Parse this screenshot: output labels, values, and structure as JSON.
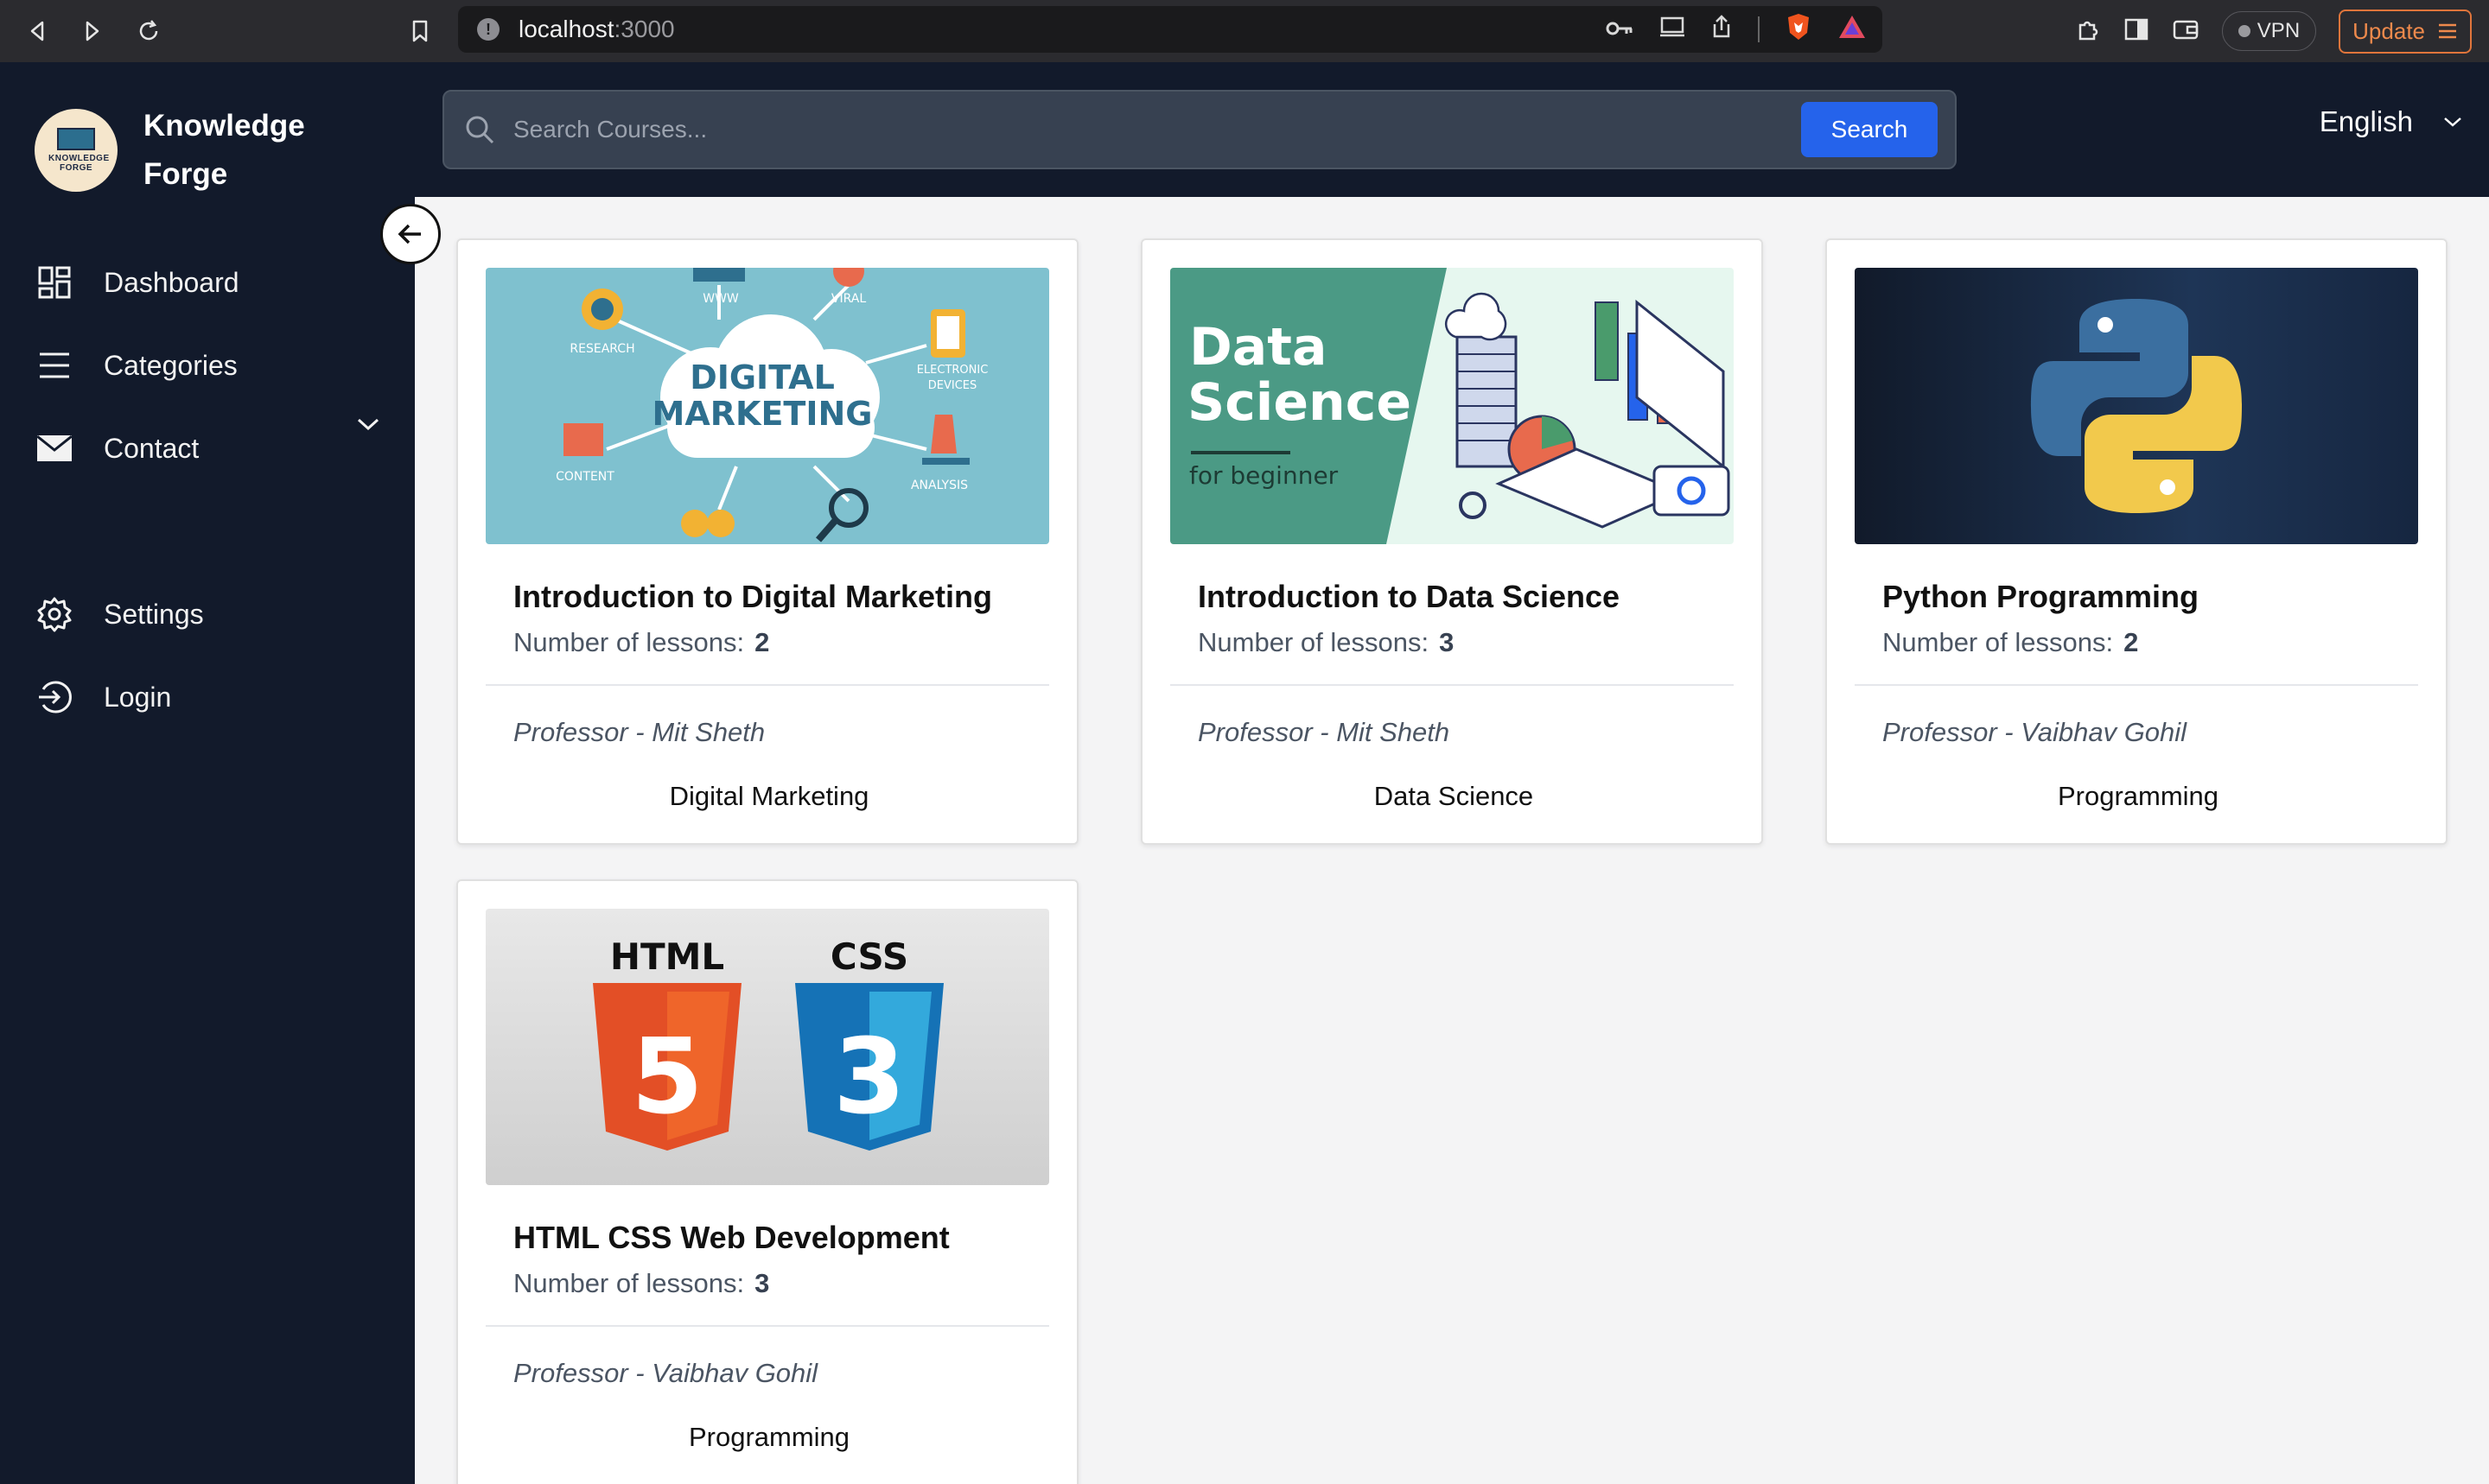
{
  "browser": {
    "url_host": "localhost",
    "url_port": ":3000",
    "vpn_label": "VPN",
    "update_label": "Update"
  },
  "sidebar": {
    "brand_line1": "Knowledge",
    "brand_line2": "Forge",
    "logo_text": "KNOWLEDGE FORGE",
    "items": [
      {
        "label": "Dashboard",
        "icon": "dashboard-icon"
      },
      {
        "label": "Categories",
        "icon": "menu-icon"
      },
      {
        "label": "Contact",
        "icon": "mail-icon"
      },
      {
        "label": "Settings",
        "icon": "gear-icon"
      },
      {
        "label": "Login",
        "icon": "login-icon"
      }
    ]
  },
  "search": {
    "placeholder": "Search Courses...",
    "button_label": "Search"
  },
  "language": {
    "selected": "English"
  },
  "courses": [
    {
      "title": "Introduction to Digital Marketing",
      "lessons_label": "Number of lessons:",
      "lessons": "2",
      "professor": "Professor - Mit Sheth",
      "category": "Digital Marketing",
      "image": {
        "heading_line1": "DIGITAL",
        "heading_line2": "MARKETING",
        "labels": [
          "WWW",
          "VIRAL",
          "RESEARCH",
          "ELECTRONIC",
          "DEVICES",
          "CONTENT",
          "ANALYSIS"
        ]
      }
    },
    {
      "title": "Introduction to Data Science",
      "lessons_label": "Number of lessons:",
      "lessons": "3",
      "professor": "Professor - Mit Sheth",
      "category": "Data Science",
      "image": {
        "heading_line1": "Data",
        "heading_line2": "Science",
        "sub": "for beginner"
      }
    },
    {
      "title": "Python Programming",
      "lessons_label": "Number of lessons:",
      "lessons": "2",
      "professor": "Professor - Vaibhav Gohil",
      "category": "Programming"
    },
    {
      "title": "HTML CSS Web Development",
      "lessons_label": "Number of lessons:",
      "lessons": "3",
      "professor": "Professor - Vaibhav Gohil",
      "category": "Programming",
      "image": {
        "label_html": "HTML",
        "label_css": "CSS",
        "num_html": "5",
        "num_css": "3"
      }
    }
  ],
  "colors": {
    "sidebar_bg": "#121a2b",
    "content_bg": "#f4f4f5",
    "search_button": "#2563eb",
    "update_accent": "#e0753b"
  }
}
